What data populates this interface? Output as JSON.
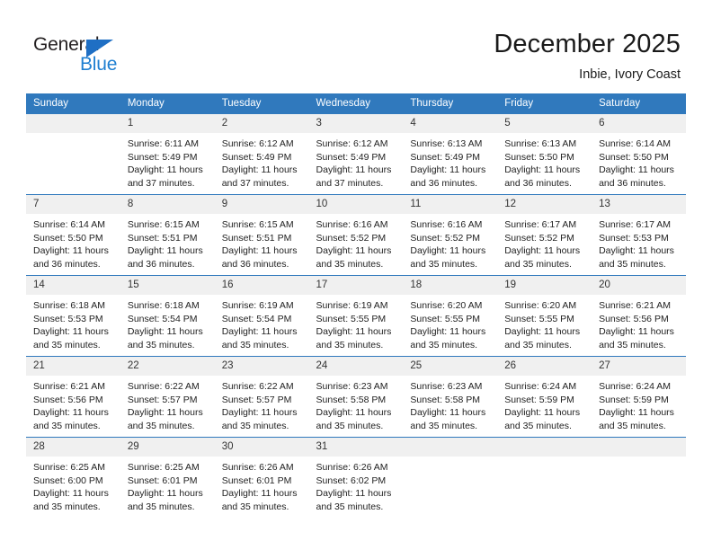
{
  "brand": {
    "name_top": "General",
    "name_bottom": "Blue",
    "triangle_color": "#1f6fc4",
    "blue_color": "#1f7fd1"
  },
  "header": {
    "title": "December 2025",
    "subtitle": "Inbie, Ivory Coast"
  },
  "theme": {
    "header_blue": "#3079bd",
    "daynum_band": "#f0f0f0",
    "text": "#222222"
  },
  "weekday_headers": [
    "Sunday",
    "Monday",
    "Tuesday",
    "Wednesday",
    "Thursday",
    "Friday",
    "Saturday"
  ],
  "weeks": [
    [
      {
        "day": "",
        "lines": []
      },
      {
        "day": "1",
        "lines": [
          "Sunrise: 6:11 AM",
          "Sunset: 5:49 PM",
          "Daylight: 11 hours",
          "and 37 minutes."
        ]
      },
      {
        "day": "2",
        "lines": [
          "Sunrise: 6:12 AM",
          "Sunset: 5:49 PM",
          "Daylight: 11 hours",
          "and 37 minutes."
        ]
      },
      {
        "day": "3",
        "lines": [
          "Sunrise: 6:12 AM",
          "Sunset: 5:49 PM",
          "Daylight: 11 hours",
          "and 37 minutes."
        ]
      },
      {
        "day": "4",
        "lines": [
          "Sunrise: 6:13 AM",
          "Sunset: 5:49 PM",
          "Daylight: 11 hours",
          "and 36 minutes."
        ]
      },
      {
        "day": "5",
        "lines": [
          "Sunrise: 6:13 AM",
          "Sunset: 5:50 PM",
          "Daylight: 11 hours",
          "and 36 minutes."
        ]
      },
      {
        "day": "6",
        "lines": [
          "Sunrise: 6:14 AM",
          "Sunset: 5:50 PM",
          "Daylight: 11 hours",
          "and 36 minutes."
        ]
      }
    ],
    [
      {
        "day": "7",
        "lines": [
          "Sunrise: 6:14 AM",
          "Sunset: 5:50 PM",
          "Daylight: 11 hours",
          "and 36 minutes."
        ]
      },
      {
        "day": "8",
        "lines": [
          "Sunrise: 6:15 AM",
          "Sunset: 5:51 PM",
          "Daylight: 11 hours",
          "and 36 minutes."
        ]
      },
      {
        "day": "9",
        "lines": [
          "Sunrise: 6:15 AM",
          "Sunset: 5:51 PM",
          "Daylight: 11 hours",
          "and 36 minutes."
        ]
      },
      {
        "day": "10",
        "lines": [
          "Sunrise: 6:16 AM",
          "Sunset: 5:52 PM",
          "Daylight: 11 hours",
          "and 35 minutes."
        ]
      },
      {
        "day": "11",
        "lines": [
          "Sunrise: 6:16 AM",
          "Sunset: 5:52 PM",
          "Daylight: 11 hours",
          "and 35 minutes."
        ]
      },
      {
        "day": "12",
        "lines": [
          "Sunrise: 6:17 AM",
          "Sunset: 5:52 PM",
          "Daylight: 11 hours",
          "and 35 minutes."
        ]
      },
      {
        "day": "13",
        "lines": [
          "Sunrise: 6:17 AM",
          "Sunset: 5:53 PM",
          "Daylight: 11 hours",
          "and 35 minutes."
        ]
      }
    ],
    [
      {
        "day": "14",
        "lines": [
          "Sunrise: 6:18 AM",
          "Sunset: 5:53 PM",
          "Daylight: 11 hours",
          "and 35 minutes."
        ]
      },
      {
        "day": "15",
        "lines": [
          "Sunrise: 6:18 AM",
          "Sunset: 5:54 PM",
          "Daylight: 11 hours",
          "and 35 minutes."
        ]
      },
      {
        "day": "16",
        "lines": [
          "Sunrise: 6:19 AM",
          "Sunset: 5:54 PM",
          "Daylight: 11 hours",
          "and 35 minutes."
        ]
      },
      {
        "day": "17",
        "lines": [
          "Sunrise: 6:19 AM",
          "Sunset: 5:55 PM",
          "Daylight: 11 hours",
          "and 35 minutes."
        ]
      },
      {
        "day": "18",
        "lines": [
          "Sunrise: 6:20 AM",
          "Sunset: 5:55 PM",
          "Daylight: 11 hours",
          "and 35 minutes."
        ]
      },
      {
        "day": "19",
        "lines": [
          "Sunrise: 6:20 AM",
          "Sunset: 5:55 PM",
          "Daylight: 11 hours",
          "and 35 minutes."
        ]
      },
      {
        "day": "20",
        "lines": [
          "Sunrise: 6:21 AM",
          "Sunset: 5:56 PM",
          "Daylight: 11 hours",
          "and 35 minutes."
        ]
      }
    ],
    [
      {
        "day": "21",
        "lines": [
          "Sunrise: 6:21 AM",
          "Sunset: 5:56 PM",
          "Daylight: 11 hours",
          "and 35 minutes."
        ]
      },
      {
        "day": "22",
        "lines": [
          "Sunrise: 6:22 AM",
          "Sunset: 5:57 PM",
          "Daylight: 11 hours",
          "and 35 minutes."
        ]
      },
      {
        "day": "23",
        "lines": [
          "Sunrise: 6:22 AM",
          "Sunset: 5:57 PM",
          "Daylight: 11 hours",
          "and 35 minutes."
        ]
      },
      {
        "day": "24",
        "lines": [
          "Sunrise: 6:23 AM",
          "Sunset: 5:58 PM",
          "Daylight: 11 hours",
          "and 35 minutes."
        ]
      },
      {
        "day": "25",
        "lines": [
          "Sunrise: 6:23 AM",
          "Sunset: 5:58 PM",
          "Daylight: 11 hours",
          "and 35 minutes."
        ]
      },
      {
        "day": "26",
        "lines": [
          "Sunrise: 6:24 AM",
          "Sunset: 5:59 PM",
          "Daylight: 11 hours",
          "and 35 minutes."
        ]
      },
      {
        "day": "27",
        "lines": [
          "Sunrise: 6:24 AM",
          "Sunset: 5:59 PM",
          "Daylight: 11 hours",
          "and 35 minutes."
        ]
      }
    ],
    [
      {
        "day": "28",
        "lines": [
          "Sunrise: 6:25 AM",
          "Sunset: 6:00 PM",
          "Daylight: 11 hours",
          "and 35 minutes."
        ]
      },
      {
        "day": "29",
        "lines": [
          "Sunrise: 6:25 AM",
          "Sunset: 6:01 PM",
          "Daylight: 11 hours",
          "and 35 minutes."
        ]
      },
      {
        "day": "30",
        "lines": [
          "Sunrise: 6:26 AM",
          "Sunset: 6:01 PM",
          "Daylight: 11 hours",
          "and 35 minutes."
        ]
      },
      {
        "day": "31",
        "lines": [
          "Sunrise: 6:26 AM",
          "Sunset: 6:02 PM",
          "Daylight: 11 hours",
          "and 35 minutes."
        ]
      },
      {
        "day": "",
        "lines": []
      },
      {
        "day": "",
        "lines": []
      },
      {
        "day": "",
        "lines": []
      }
    ]
  ]
}
